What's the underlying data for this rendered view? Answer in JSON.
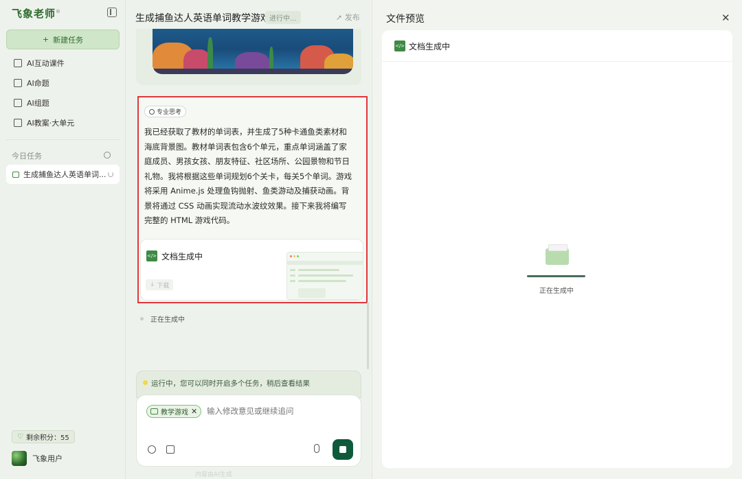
{
  "sidebar": {
    "brand": "飞象老师",
    "brand_mark": "®",
    "new_task": "新建任务",
    "new_task_icon": "+",
    "nav": [
      {
        "label": "AI互动课件",
        "icon": "play-icon"
      },
      {
        "label": "AI命题",
        "icon": "list-icon"
      },
      {
        "label": "AI组题",
        "icon": "image-icon"
      },
      {
        "label": "AI教案·大单元",
        "icon": "book-icon"
      }
    ],
    "today_label": "今日任务",
    "task_item": "生成捕鱼达人英语单词...",
    "credits": "剩余积分：55",
    "user_name": "飞象用户"
  },
  "chat": {
    "title": "生成捕鱼达人英语单词教学游戏",
    "status": "进行中...",
    "publish": "发布",
    "think_badge": "专业思考",
    "reasoning": "我已经获取了教材的单词表，并生成了5种卡通鱼类素材和海底背景图。教材单词表包含6个单元，重点单词涵盖了家庭成员、男孩女孩、朋友特征、社区场所、公园景物和节日礼物。我将根据这些单词规划6个关卡，每关5个单词。游戏将采用 Anime.js 处理鱼钩抛射、鱼类游动及捕获动画。背景将通过 CSS 动画实现流动水波纹效果。接下来我将编写完整的 HTML 游戏代码。",
    "doc_card_title": "文档生成中",
    "doc_download": "下载",
    "generating": "正在生成中",
    "run_banner": "运行中，您可以同时开启多个任务，稍后查看结果",
    "tag": "教学游戏",
    "input_placeholder": "输入修改意见或继续追问",
    "footnote": "内容由AI生成"
  },
  "preview": {
    "title": "文件预览",
    "close": "✕",
    "doc_title": "文档生成中",
    "status": "正在生成中"
  },
  "colors": {
    "accent": "#2f6b2f",
    "highlight_border": "#e0353a",
    "stop_button": "#0f5a3a"
  }
}
